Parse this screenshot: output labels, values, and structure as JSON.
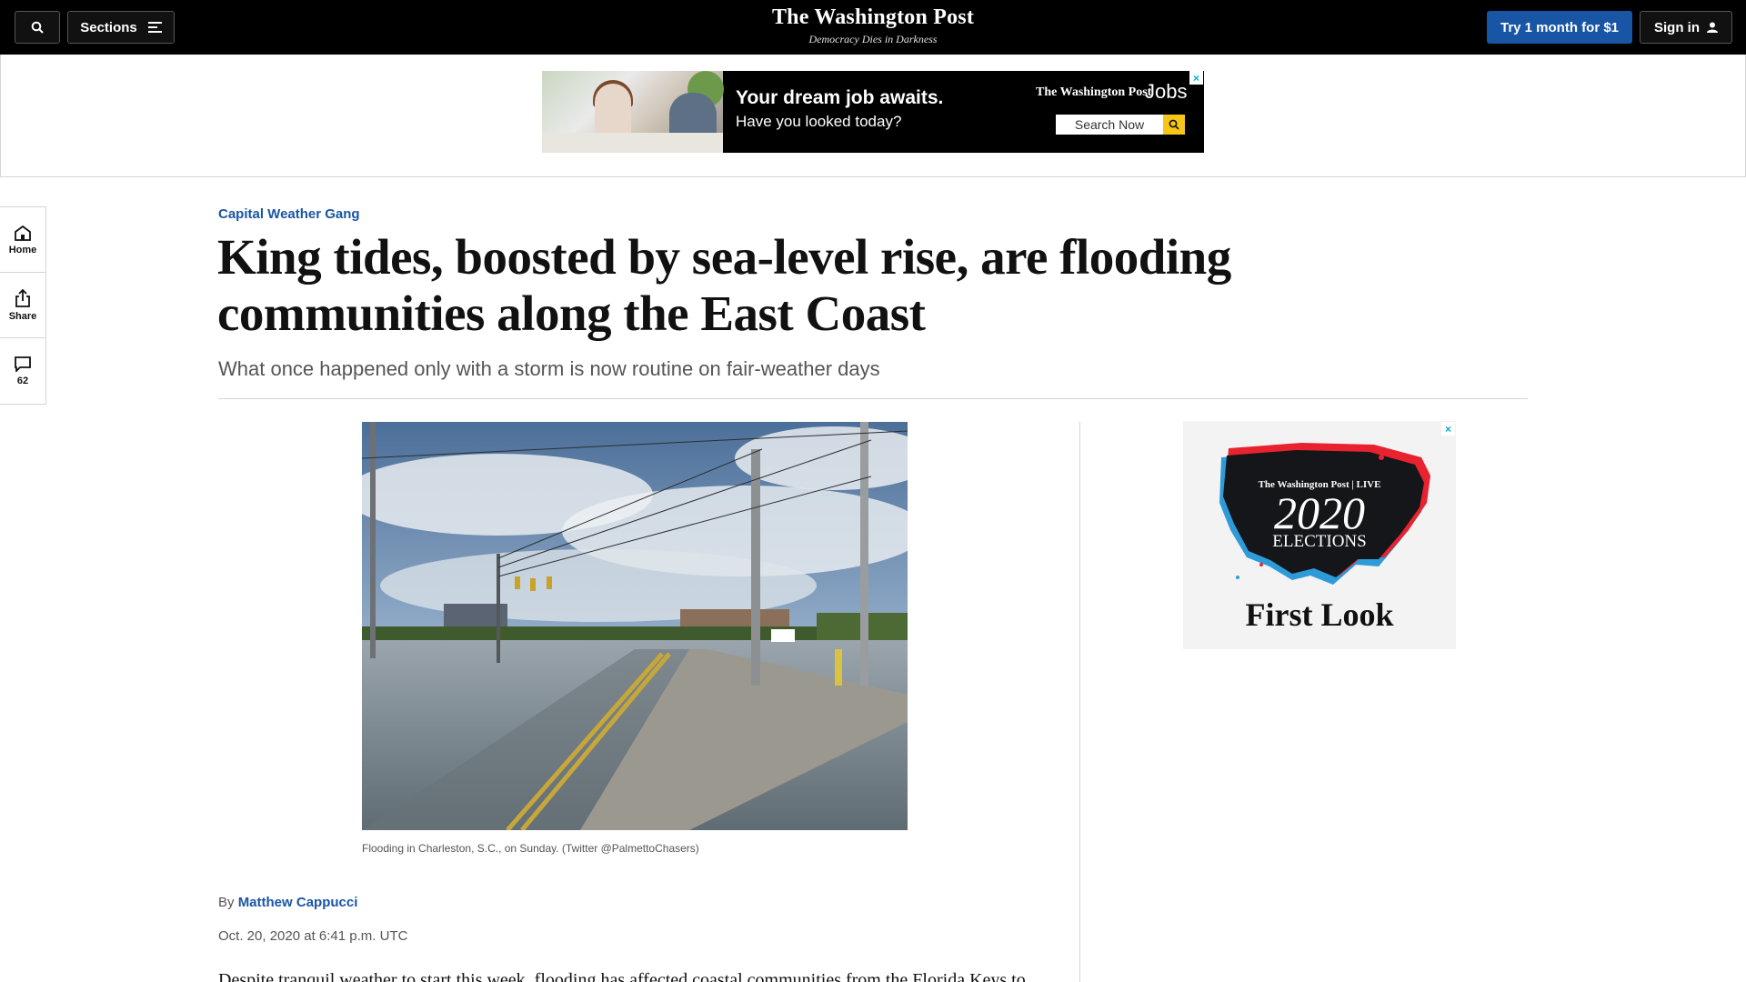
{
  "header": {
    "sections_label": "Sections",
    "masthead": "The Washington Post",
    "tagline": "Democracy Dies in Darkness",
    "subscribe_label": "Try 1 month for $1",
    "signin_label": "Sign in"
  },
  "banner_ad": {
    "headline": "Your dream job awaits.",
    "subhead": "Have you looked today?",
    "brand": "The Washington Post",
    "product": "Jobs",
    "search_label": "Search Now",
    "close": "×"
  },
  "left_rail": {
    "home_label": "Home",
    "share_label": "Share",
    "comment_count": "62"
  },
  "article": {
    "kicker": "Capital Weather Gang",
    "headline": "King tides, boosted by sea-level rise, are flooding communities along the East Coast",
    "dek": "What once happened only with a storm is now routine on fair-weather days",
    "caption": "Flooding in Charleston, S.C., on Sunday. (Twitter @PalmettoChasers)",
    "byline_prefix": "By",
    "author": "Matthew Cappucci",
    "timestamp": "Oct. 20, 2020 at 6:41 p.m. UTC",
    "body_start": "Despite tranquil weather to start this week, flooding has affected coastal communities from the Florida Keys to"
  },
  "side_ad": {
    "brand": "The Washington Post | LIVE",
    "year": "2020",
    "title": "ELECTIONS",
    "tagline": "First Look",
    "close": "×"
  },
  "colors": {
    "topbar": "#000000",
    "accent_blue": "#1955a5",
    "ad_close": "#00aecd",
    "map_red": "#e8222e",
    "map_blue": "#2e9bd9"
  }
}
